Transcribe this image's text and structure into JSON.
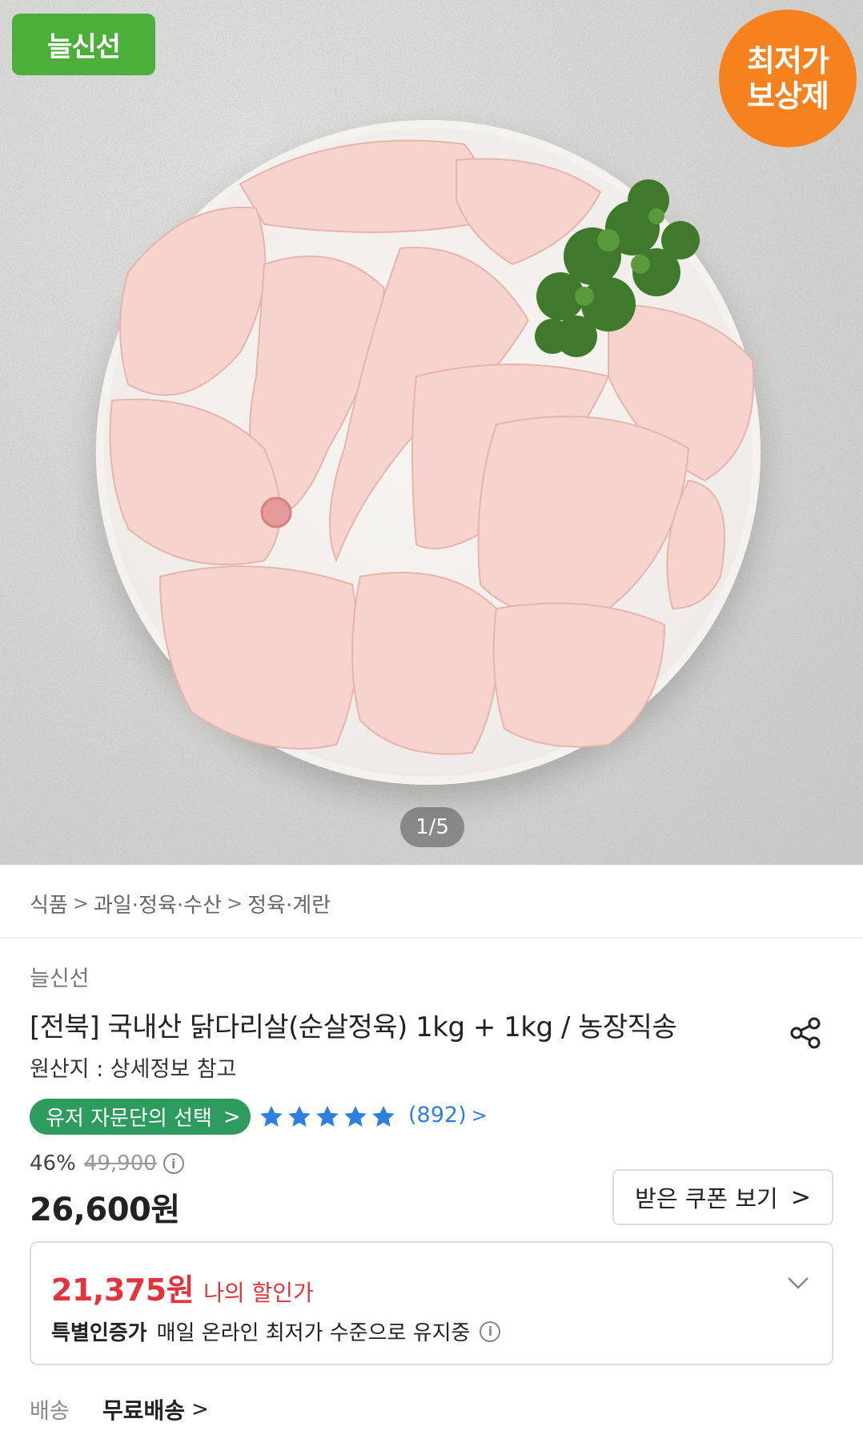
{
  "hero": {
    "brand_badge": "늘신선",
    "price_badge_line1": "최저가",
    "price_badge_line2": "보상제",
    "pager": "1/5"
  },
  "breadcrumb": [
    "식품",
    "과일·정육·수산",
    "정육·계란"
  ],
  "product": {
    "seller": "늘신선",
    "title": "[전북] 국내산 닭다리살(순살정육) 1kg + 1kg / 농장직송",
    "origin": "원산지 : 상세정보 참고",
    "choice_label": "유저 자문단의 선택",
    "rating_stars": 5,
    "review_count": "(892)",
    "discount_rate": "46%",
    "original_price": "49,900",
    "price": "26,600원",
    "coupon_button": "받은 쿠폰 보기"
  },
  "my_price": {
    "amount": "21,375원",
    "label": "나의 할인가",
    "cert_label": "특별인증가",
    "cert_text": "매일 온라인 최저가 수준으로 유지중"
  },
  "shipping": {
    "label": "배송",
    "value": "무료배송"
  },
  "colors": {
    "brand_green": "#4caf3a",
    "choice_green": "#2e9b5e",
    "badge_orange": "#f5821f",
    "star_blue": "#2f7fe0",
    "sale_red": "#e2343f"
  },
  "icons": {
    "share": "share-icon",
    "info": "info-icon",
    "star": "star-icon",
    "chevron_right": "chevron-right-icon",
    "chevron_down": "chevron-down-icon"
  }
}
